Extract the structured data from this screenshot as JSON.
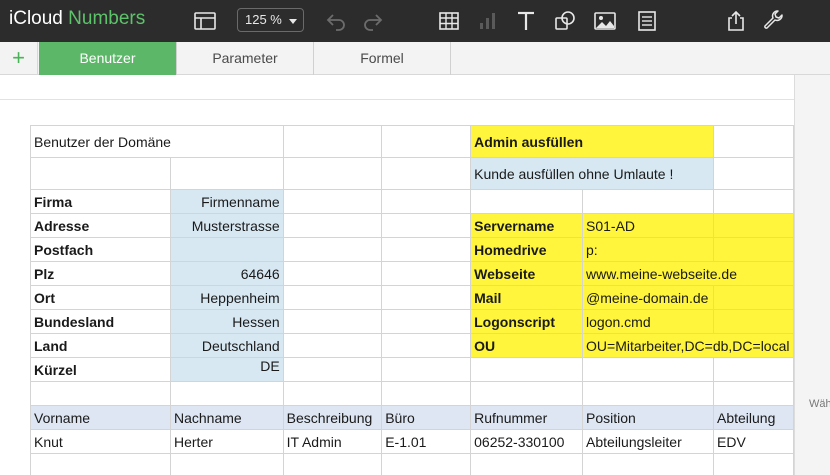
{
  "toolbar": {
    "brand": "iCloud",
    "product": "Numbers",
    "zoom": "125 %"
  },
  "tabs": [
    {
      "label": "Benutzer"
    },
    {
      "label": "Parameter"
    },
    {
      "label": "Formel"
    }
  ],
  "sheet": {
    "title": "Benutzer der Domäne",
    "admin_hint": "Admin ausfüllen",
    "customer_hint": "Kunde ausfüllen ohne Umlaute !",
    "fields": [
      {
        "label": "Firma",
        "value": "Firmenname"
      },
      {
        "label": "Adresse",
        "value": "Musterstrasse"
      },
      {
        "label": "Postfach",
        "value": ""
      },
      {
        "label": "Plz",
        "value": "64646"
      },
      {
        "label": "Ort",
        "value": "Heppenheim"
      },
      {
        "label": "Bundesland",
        "value": "Hessen"
      },
      {
        "label": "Land",
        "value": "Deutschland"
      },
      {
        "label": "Kürzel",
        "value": "DE"
      }
    ],
    "admin_fields": [
      {
        "label": "Servername",
        "value": "S01-AD"
      },
      {
        "label": "Homedrive",
        "value": "p:"
      },
      {
        "label": "Webseite",
        "value": "www.meine-webseite.de"
      },
      {
        "label": "Mail",
        "value": "@meine-domain.de"
      },
      {
        "label": "Logonscript",
        "value": "logon.cmd"
      },
      {
        "label": "OU",
        "value": "OU=Mitarbeiter,DC=db,DC=local"
      }
    ],
    "user_table": {
      "columns": [
        "Vorname",
        "Nachname",
        "Beschreibung",
        "Büro",
        "Rufnummer",
        "Position",
        "Abteilung"
      ],
      "rows": [
        [
          "Knut",
          "Herter",
          "IT Admin",
          "E-1.01",
          "06252-330100",
          "Abteilungsleiter",
          "EDV"
        ]
      ]
    }
  },
  "side_panel": {
    "hint": "Wäh"
  },
  "colors": {
    "toolbar": "#2c2c2c",
    "accent_green": "#5cb868",
    "highlight_yellow": "#fff53d",
    "admin_red": "#e8402a",
    "input_blue": "#d7e8f3",
    "label_navy": "#27476b"
  },
  "icons": [
    "sidebar-icon",
    "undo-icon",
    "redo-icon",
    "table-icon",
    "chart-icon",
    "text-icon",
    "shape-icon",
    "image-icon",
    "comment-icon",
    "share-icon",
    "wrench-icon",
    "add-sheet-icon"
  ]
}
